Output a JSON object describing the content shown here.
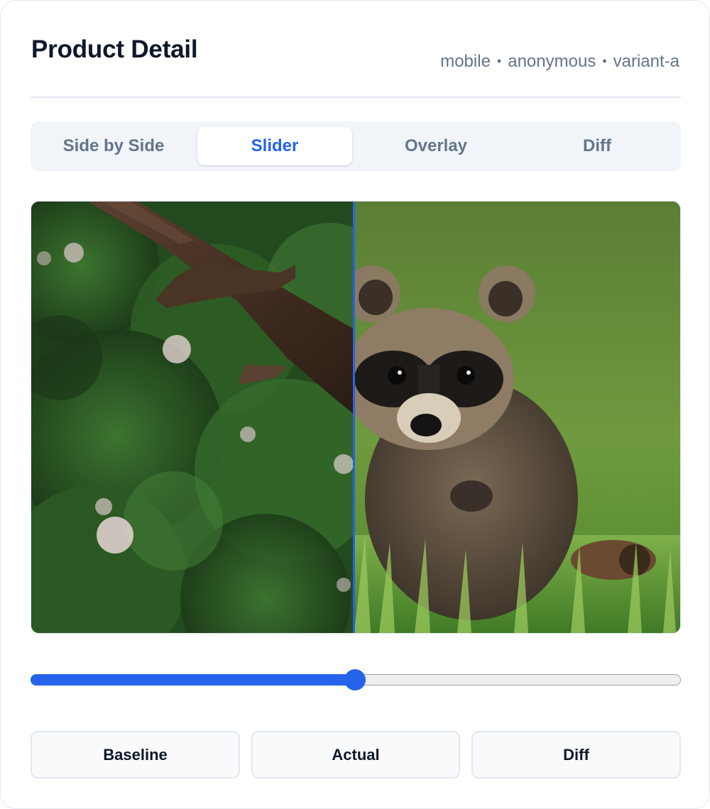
{
  "header": {
    "title": "Product Detail",
    "meta": [
      "mobile",
      "anonymous",
      "variant-a"
    ],
    "separator": "•"
  },
  "tabs": [
    {
      "label": "Side by Side",
      "active": false
    },
    {
      "label": "Slider",
      "active": true
    },
    {
      "label": "Overlay",
      "active": false
    },
    {
      "label": "Diff",
      "active": false
    }
  ],
  "comparison": {
    "left_image": "baseline-photo-branch",
    "right_image": "actual-photo-raccoon",
    "slider_position": 0.5
  },
  "buttons": {
    "baseline": "Baseline",
    "actual": "Actual",
    "diff": "Diff"
  },
  "colors": {
    "accent": "#2563eb",
    "title": "#0f172a",
    "muted": "#64748b",
    "border": "#e2e8f0"
  }
}
